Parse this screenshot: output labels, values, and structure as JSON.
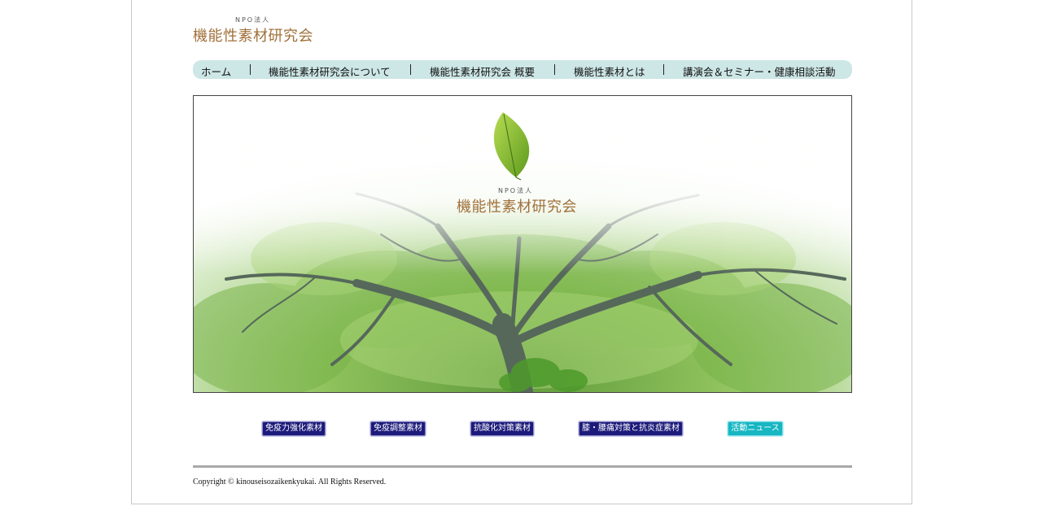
{
  "logo": {
    "npo": "NPO法人",
    "name": "機能性素材研究会"
  },
  "nav": {
    "items": [
      {
        "label": "ホーム"
      },
      {
        "label": "機能性素材研究会について"
      },
      {
        "label": "機能性素材研究会 概要"
      },
      {
        "label": "機能性素材とは"
      },
      {
        "label": "講演会＆セミナー・健康相談活動"
      }
    ]
  },
  "hero": {
    "npo": "NPO法人",
    "name": "機能性素材研究会"
  },
  "buttons": [
    {
      "label": "免疫力強化素材"
    },
    {
      "label": "免疫調整素材"
    },
    {
      "label": "抗酸化対策素材"
    },
    {
      "label": "膝・腰痛対策と抗炎症素材"
    },
    {
      "label": "活動ニュース"
    }
  ],
  "footer": {
    "copyright": "Copyright © kinouseisozaikenkyukai. All Rights Reserved."
  },
  "colors": {
    "brand_brown": "#a0703a",
    "nav_bg": "#cde6e6",
    "button_navy": "#1c1a7a",
    "button_teal": "#16b6c2"
  }
}
